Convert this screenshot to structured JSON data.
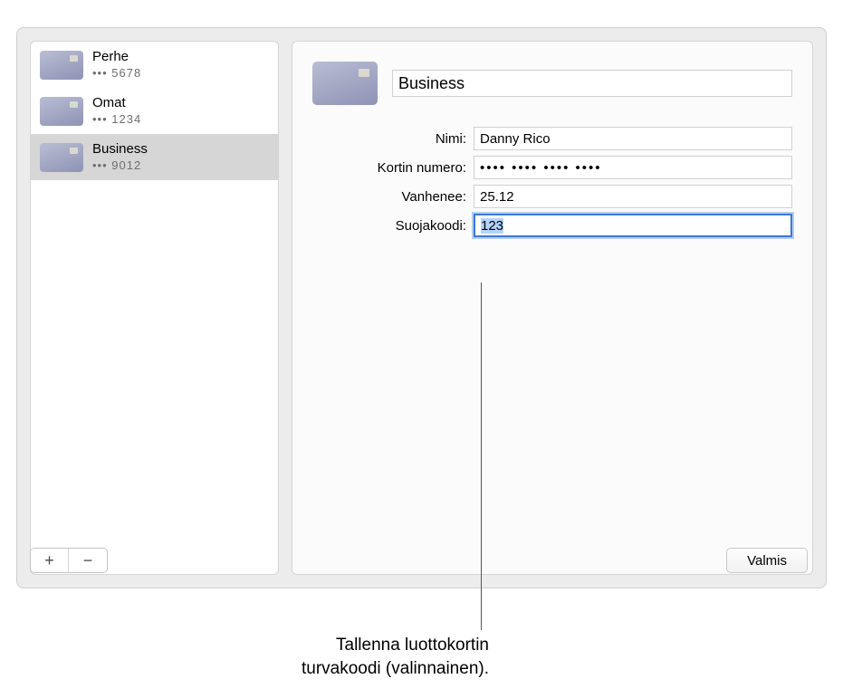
{
  "sidebar": {
    "items": [
      {
        "name": "Perhe",
        "last4": "••• 5678"
      },
      {
        "name": "Omat",
        "last4": "••• 1234"
      },
      {
        "name": "Business",
        "last4": "••• 9012"
      }
    ],
    "selected_index": 2
  },
  "detail": {
    "title_value": "Business",
    "labels": {
      "name": "Nimi:",
      "number": "Kortin numero:",
      "expires": "Vanhenee:",
      "cvv": "Suojakoodi:"
    },
    "values": {
      "name": "Danny Rico",
      "number_masked": "•••• •••• •••• ••••",
      "expires": "25.12",
      "cvv": "123"
    }
  },
  "toolbar": {
    "add": "+",
    "remove": "−",
    "done": "Valmis"
  },
  "callout": {
    "line1": "Tallenna luottokortin",
    "line2": "turvakoodi (valinnainen)."
  }
}
